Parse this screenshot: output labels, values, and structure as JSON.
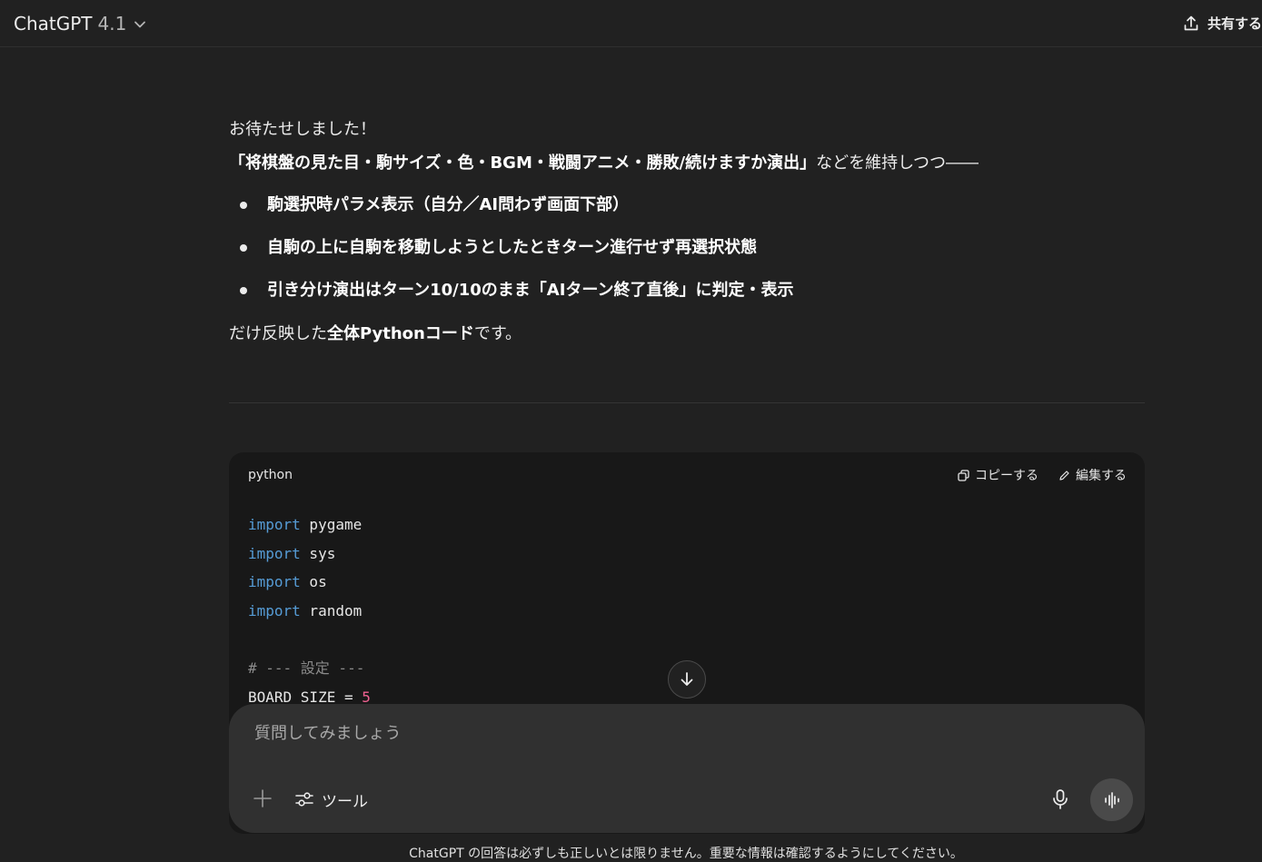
{
  "header": {
    "model_name": "ChatGPT",
    "model_version": "4.1",
    "share_label": "共有する"
  },
  "message": {
    "line1": "お待たせしました！",
    "line2_bold": "「将棋盤の見た目・駒サイズ・色・BGM・戦闘アニメ・勝敗/続けますか演出」",
    "line2_rest": "などを維持しつつ――",
    "bullets": [
      "駒選択時パラメ表示（自分／AI問わず画面下部）",
      "自駒の上に自駒を移動しようとしたときターン進行せず再選択状態",
      "引き分け演出はターン10/10のまま「AIターン終了直後」に判定・表示"
    ],
    "closing_pre": "だけ反映した",
    "closing_bold": "全体Pythonコード",
    "closing_post": "です。"
  },
  "code": {
    "language": "python",
    "copy_label": "コピーする",
    "edit_label": "編集する",
    "lines": [
      {
        "kw": "import",
        "rest": " pygame"
      },
      {
        "kw": "import",
        "rest": " sys"
      },
      {
        "kw": "import",
        "rest": " os"
      },
      {
        "kw": "import",
        "rest": " random"
      }
    ],
    "comment": "# --- 設定 ---",
    "last_line_pre": "BOARD_SIZE = ",
    "last_line_num": "5"
  },
  "composer": {
    "placeholder": "質問してみましょう",
    "tools_label": "ツール"
  },
  "footer": {
    "disclaimer": "ChatGPT の回答は必ずしも正しいとは限りません。重要な情報は確認するようにしてください。"
  }
}
